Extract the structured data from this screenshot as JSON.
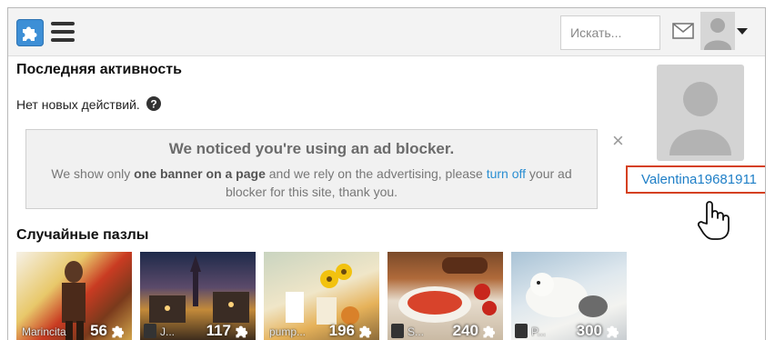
{
  "header": {
    "search_placeholder": "Искать...",
    "logo_icon": "puzzle-logo-icon",
    "menu_icon": "hamburger-menu-icon",
    "mail_icon": "mail-icon",
    "avatar_icon": "user-avatar-icon",
    "dropdown_icon": "caret-down-icon"
  },
  "activity": {
    "title": "Последняя активность",
    "empty_text": "Нет новых действий."
  },
  "ad_notice": {
    "title": "We noticed you're using an ad blocker.",
    "text_before": "We show only ",
    "text_bold": "one banner on a page",
    "text_middle": " and we rely on the advertising, please ",
    "link": "turn off",
    "text_after": " your ad blocker for this site, thank you.",
    "close": "×"
  },
  "profile": {
    "username": "Valentina19681911"
  },
  "random_puzzles": {
    "title": "Случайные пазлы",
    "items": [
      {
        "author": "Marincita",
        "pieces": "56"
      },
      {
        "author": "J...",
        "pieces": "117"
      },
      {
        "author": "pump...",
        "pieces": "196"
      },
      {
        "author": "S...",
        "pieces": "240"
      },
      {
        "author": "P...",
        "pieces": "300"
      }
    ]
  },
  "colors": {
    "accent_link": "#2a8ed2",
    "highlight_border": "#d5401e",
    "logo_blue": "#3d8fd6"
  }
}
